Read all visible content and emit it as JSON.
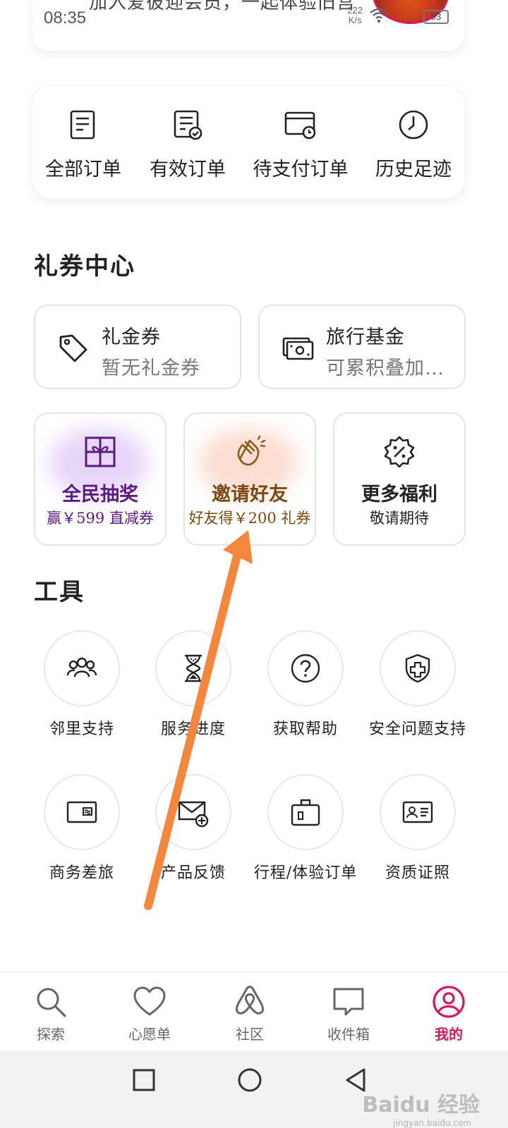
{
  "status_bar": {
    "time": "08:35",
    "net_speed_value": "222",
    "net_speed_unit": "K/s",
    "battery": "93"
  },
  "member_banner": {
    "text": "加入爱彼迎会员，一起体验旧宫"
  },
  "orders": [
    {
      "label": "全部订单",
      "icon": "document-list-icon"
    },
    {
      "label": "有效订单",
      "icon": "document-check-icon"
    },
    {
      "label": "待支付订单",
      "icon": "card-clock-icon"
    },
    {
      "label": "历史足迹",
      "icon": "clock-icon"
    }
  ],
  "coupon_section": {
    "title": "礼券中心",
    "cards": [
      {
        "title": "礼金券",
        "subtitle": "暂无礼金券",
        "icon": "tag-icon"
      },
      {
        "title": "旅行基金",
        "subtitle": "可累积叠加…",
        "icon": "cash-icon"
      }
    ],
    "promos": [
      {
        "title": "全民抽奖",
        "subtitle": "赢￥599 直减券",
        "icon": "gift-box-icon",
        "color": "#5a1a80",
        "glow": "#c9a3ee"
      },
      {
        "title": "邀请好友",
        "subtitle": "好友得￥200 礼券",
        "icon": "clapping-hands-icon",
        "color": "#7a4a12",
        "glow": "#f7b49a"
      },
      {
        "title": "更多福利",
        "subtitle": "敬请期待",
        "icon": "discount-badge-icon",
        "color": "#222222",
        "glow": ""
      }
    ]
  },
  "tools_section": {
    "title": "工具",
    "items": [
      {
        "label": "邻里支持",
        "icon": "people-group-icon"
      },
      {
        "label": "服务进度",
        "icon": "hourglass-icon"
      },
      {
        "label": "获取帮助",
        "icon": "question-circle-icon"
      },
      {
        "label": "安全问题支持",
        "icon": "shield-plus-icon"
      },
      {
        "label": "商务差旅",
        "icon": "business-card-icon"
      },
      {
        "label": "产品反馈",
        "icon": "mail-plus-icon"
      },
      {
        "label": "行程/体验订单",
        "icon": "luggage-icon"
      },
      {
        "label": "资质证照",
        "icon": "id-card-icon"
      }
    ]
  },
  "bottom_nav": [
    {
      "label": "探索",
      "icon": "search-icon",
      "active": false
    },
    {
      "label": "心愿单",
      "icon": "heart-icon",
      "active": false
    },
    {
      "label": "社区",
      "icon": "airbnb-logo-icon",
      "active": false
    },
    {
      "label": "收件箱",
      "icon": "chat-bubble-icon",
      "active": false
    },
    {
      "label": "我的",
      "icon": "profile-icon",
      "active": true
    }
  ],
  "watermark": {
    "text": "Baidu 经验",
    "sub": "jingyan.baidu.com"
  },
  "colors": {
    "accent": "#d7195a",
    "arrow": "#f4873c"
  }
}
